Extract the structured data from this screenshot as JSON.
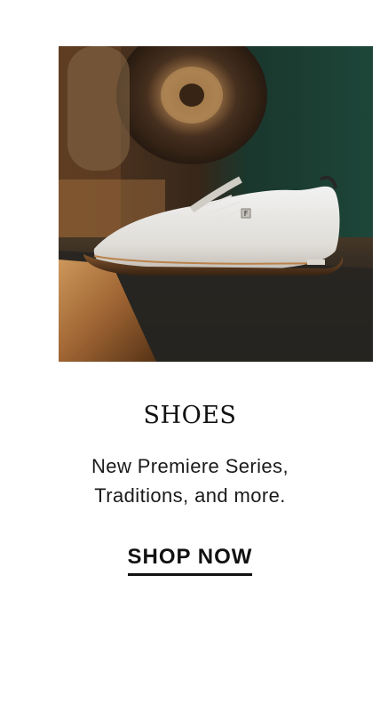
{
  "hero": {
    "image_subject": "white golf shoe on dark mat",
    "brand_mark": "F"
  },
  "content": {
    "title": "SHOES",
    "subtitle_line1": "New Premiere Series,",
    "subtitle_line2": "Traditions, and more."
  },
  "cta": {
    "label": "SHOP NOW"
  },
  "colors": {
    "text": "#111111",
    "background": "#ffffff",
    "accent_green": "#1f4a3c",
    "warm_wood": "#8a5a2e"
  }
}
